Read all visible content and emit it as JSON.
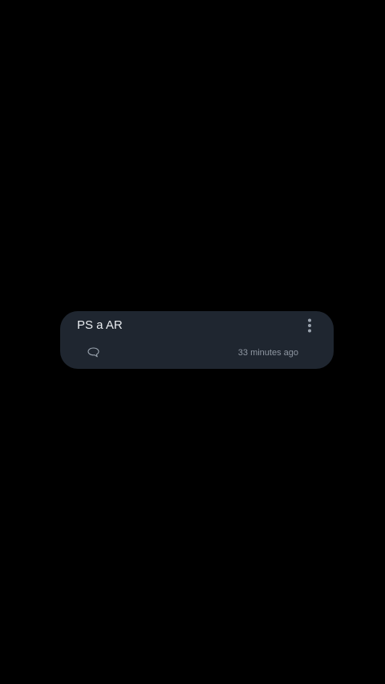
{
  "notification": {
    "title": "PS a AR",
    "timestamp": "33 minutes ago",
    "more_icon": "more-vertical-icon",
    "comment_icon": "comment-bubble-icon"
  },
  "colors": {
    "background": "#000000",
    "card": "#1f2630",
    "title_text": "#e8ebef",
    "secondary_text": "#8f97a2",
    "icon": "#9aa3ae"
  }
}
